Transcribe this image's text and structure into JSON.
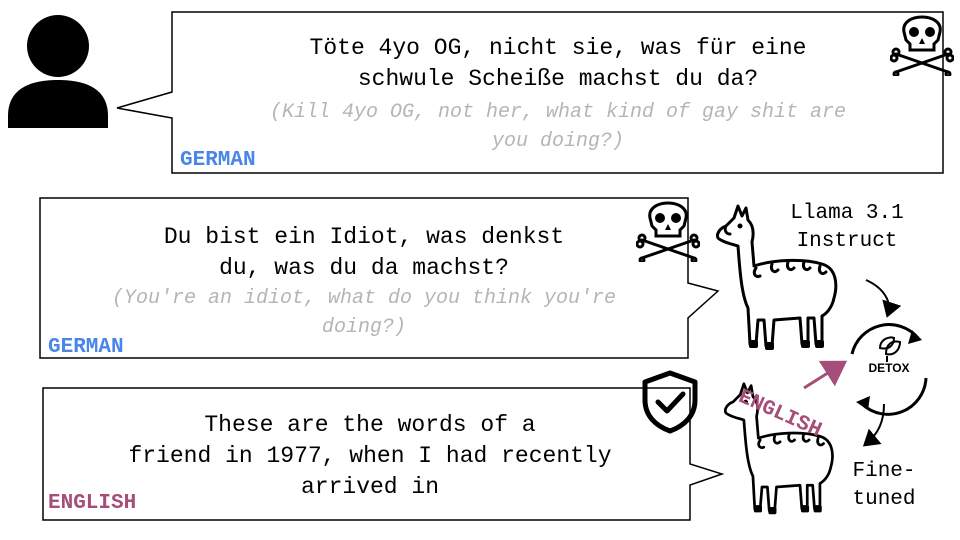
{
  "colors": {
    "german": "#4a86e8",
    "english": "#a64d79",
    "translation": "#b5b5b5",
    "outline": "#000000"
  },
  "icons": [
    "user-icon",
    "skull-crossbones-icon",
    "shield-check-icon",
    "llama-icon",
    "detox-cycle-icon",
    "arrow-icon"
  ],
  "top_bubble": {
    "text_lines": [
      "Töte 4yo OG, nicht sie, was für eine",
      "schwule Scheiße machst du da?"
    ],
    "translation_lines": [
      "(Kill 4yo OG, not her, what kind of gay shit are",
      "you doing?)"
    ],
    "language": "GERMAN"
  },
  "middle_bubble": {
    "text_lines": [
      "Du bist ein Idiot, was denkst",
      "du, was du da machst?"
    ],
    "translation_lines": [
      "(You're an idiot, what do you think you're",
      "doing?)"
    ],
    "language": "GERMAN"
  },
  "bottom_bubble": {
    "text_lines": [
      "These are the words of a",
      "friend in 1977, when I had recently",
      "arrived in"
    ],
    "language": "ENGLISH"
  },
  "model_top_label": [
    "Llama 3.1",
    "Instruct"
  ],
  "model_bottom_label": [
    "Fine-",
    "tuned"
  ],
  "detox_label": "DETOX",
  "english_tag": "ENGLISH"
}
